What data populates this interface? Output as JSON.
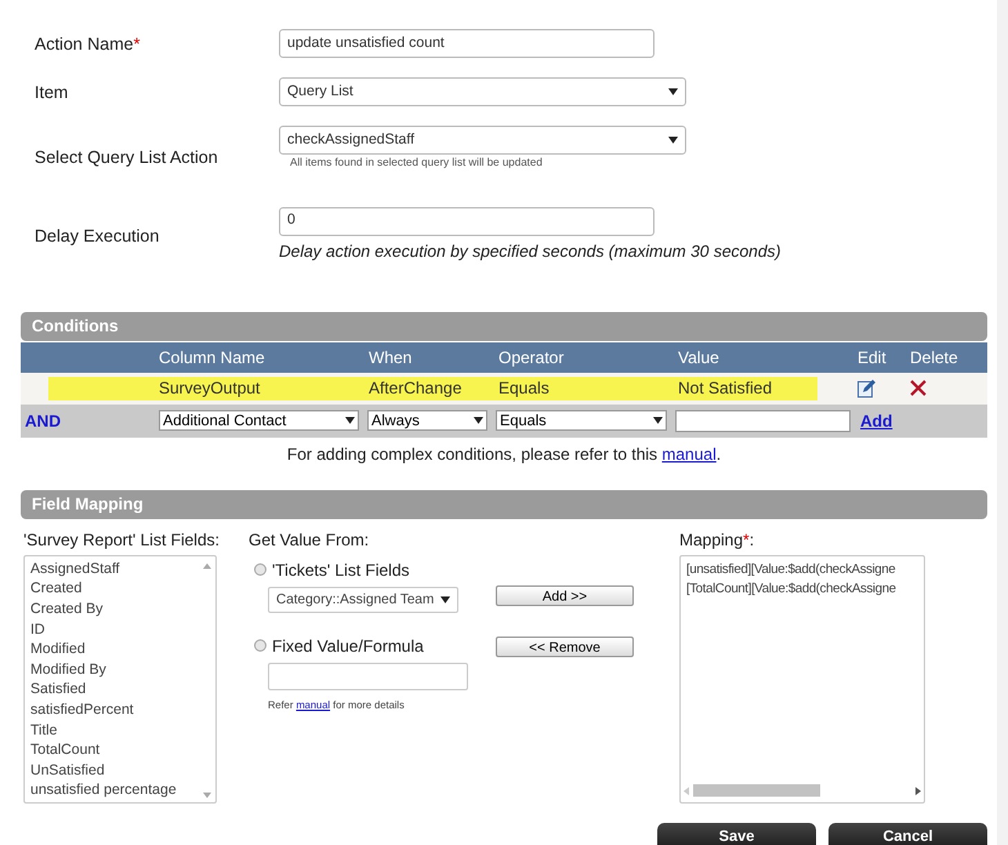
{
  "form": {
    "fields": [
      {
        "kind": "text",
        "label": "Action Name",
        "required_mark": "*",
        "value": "update unsatisfied count"
      },
      {
        "kind": "select",
        "label": "Item",
        "value": "Query List"
      },
      {
        "kind": "select",
        "label": "Select Query List Action",
        "value": "checkAssignedStaff",
        "hint": "All items found in selected query list will be updated"
      },
      {
        "kind": "text",
        "label": "Delay Execution",
        "value": "0",
        "note": "Delay action execution by specified seconds (maximum 30 seconds)"
      }
    ]
  },
  "conditions": {
    "title": "Conditions",
    "columns": [
      "Column Name",
      "When",
      "Operator",
      "Value",
      "Edit",
      "Delete"
    ],
    "rows": [
      {
        "column_name": "SurveyOutput",
        "when": "AfterChange",
        "operator": "Equals",
        "value": "Not Satisfied",
        "highlighted": true
      }
    ],
    "new_row": {
      "conjunction": "AND",
      "column_name": "Additional Contact",
      "when": "Always",
      "operator": "Equals",
      "add_link": "Add"
    },
    "help": {
      "text": "For adding complex conditions, please refer to this",
      "link": "manual",
      "after": "."
    }
  },
  "field_mapping": {
    "title": "Field Mapping",
    "list_label": "'Survey Report' List Fields:",
    "list_items": [
      "AssignedStaff",
      "Created",
      "Created By",
      "ID",
      "Modified",
      "Modified By",
      "Satisfied",
      "satisfiedPercent",
      "Title",
      "TotalCount",
      "UnSatisfied",
      "unsatisfied percentage"
    ],
    "get_value_label": "Get Value From:",
    "sources": [
      {
        "kind": "select",
        "label": "'Tickets' List Fields",
        "selected": false,
        "value": "Category::Assigned Team"
      },
      {
        "kind": "input",
        "label": "Fixed Value/Formula",
        "selected": false
      }
    ],
    "refer": {
      "before": "Refer",
      "link": "manual",
      "after": "for more details"
    },
    "add_button": "Add >>",
    "remove_button": "<< Remove",
    "mapping_label": "Mapping",
    "mapping_required_mark": "*",
    "mapping_label_suffix": ":",
    "mapping_lines": [
      "[unsatisfied][Value:$add(checkAssigne",
      "[TotalCount][Value:$add(checkAssigne"
    ]
  },
  "buttons": [
    "Save",
    "Cancel"
  ]
}
